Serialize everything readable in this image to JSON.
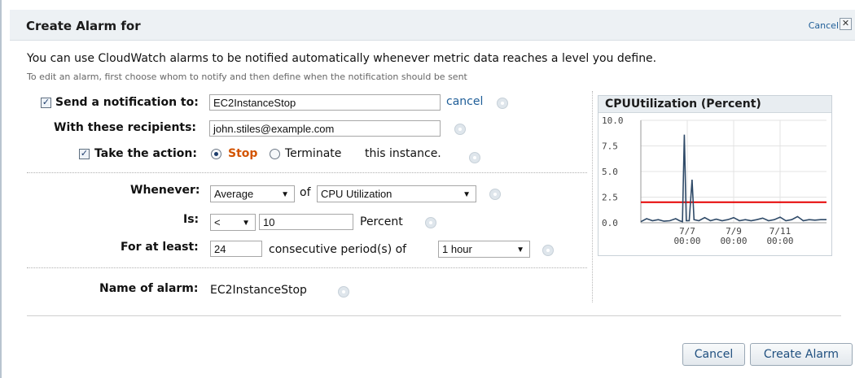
{
  "dialog": {
    "title": "Create Alarm for",
    "close_label": "Cancel",
    "close_glyph": "✕",
    "intro": "You can use CloudWatch alarms to be notified automatically whenever metric data reaches a level you define.",
    "subtext": "To edit an alarm, first choose whom to notify and then define when the notification should be sent"
  },
  "notification": {
    "checked": true,
    "label": "Send a notification to:",
    "topic": "EC2InstanceStop",
    "cancel_link": "cancel",
    "recipients_label": "With these recipients:",
    "recipients": "john.stiles@example.com"
  },
  "action": {
    "checked": true,
    "label": "Take the action:",
    "stop_label": "Stop",
    "terminate_label": "Terminate",
    "suffix": "this instance.",
    "selected": "Stop",
    "stop_color": "#d35400"
  },
  "condition": {
    "whenever_label": "Whenever:",
    "statistic": "Average",
    "of_label": "of",
    "metric": "CPU Utilization",
    "is_label": "Is:",
    "operator": "<",
    "threshold": "10",
    "unit": "Percent",
    "for_label": "For at least:",
    "periods": "24",
    "periods_text": "consecutive period(s) of",
    "period": "1 hour"
  },
  "name": {
    "label": "Name of alarm:",
    "value": "EC2InstanceStop"
  },
  "buttons": {
    "cancel": "Cancel",
    "create": "Create Alarm"
  },
  "chart_data": {
    "type": "line",
    "title": "CPUUtilization (Percent)",
    "ylim": [
      0,
      10
    ],
    "yticks": [
      "10.0",
      "7.5",
      "5.0",
      "2.5",
      "0.0"
    ],
    "ytick_values": [
      10,
      7.5,
      5,
      2.5,
      0
    ],
    "x_range": [
      0,
      192
    ],
    "xticks": [
      {
        "x": 48,
        "line1": "7/7",
        "line2": "00:00"
      },
      {
        "x": 96,
        "line1": "7/9",
        "line2": "00:00"
      },
      {
        "x": 144,
        "line1": "7/11",
        "line2": "00:00"
      }
    ],
    "grid": true,
    "threshold": {
      "value": 2,
      "color": "#e60000"
    },
    "series": [
      {
        "color": "#2f4a68",
        "points": [
          [
            0,
            0.1
          ],
          [
            6,
            0.4
          ],
          [
            12,
            0.2
          ],
          [
            18,
            0.3
          ],
          [
            24,
            0.15
          ],
          [
            30,
            0.2
          ],
          [
            36,
            0.4
          ],
          [
            40,
            0.2
          ],
          [
            43,
            0.1
          ],
          [
            45,
            8.6
          ],
          [
            47,
            0.2
          ],
          [
            50,
            0.2
          ],
          [
            53,
            4.2
          ],
          [
            55,
            0.3
          ],
          [
            60,
            0.2
          ],
          [
            66,
            0.5
          ],
          [
            72,
            0.2
          ],
          [
            78,
            0.35
          ],
          [
            84,
            0.2
          ],
          [
            90,
            0.3
          ],
          [
            96,
            0.5
          ],
          [
            102,
            0.2
          ],
          [
            108,
            0.3
          ],
          [
            114,
            0.2
          ],
          [
            120,
            0.3
          ],
          [
            126,
            0.45
          ],
          [
            132,
            0.2
          ],
          [
            138,
            0.3
          ],
          [
            144,
            0.55
          ],
          [
            150,
            0.2
          ],
          [
            156,
            0.3
          ],
          [
            162,
            0.6
          ],
          [
            168,
            0.2
          ],
          [
            174,
            0.3
          ],
          [
            180,
            0.25
          ],
          [
            186,
            0.3
          ],
          [
            192,
            0.3
          ]
        ]
      }
    ]
  },
  "colors": {
    "link": "#1f5e98",
    "header_bg": "#edf1f4",
    "panel_bg": "#e8edf1"
  }
}
